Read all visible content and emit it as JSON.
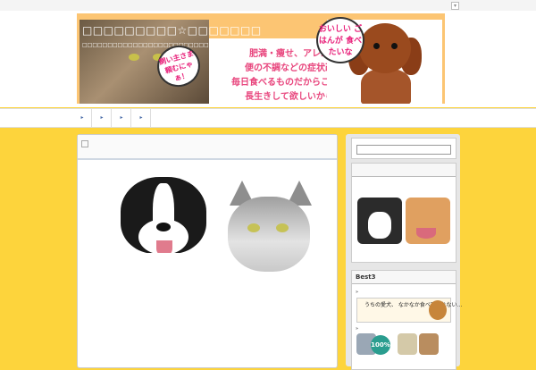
{
  "header": {
    "site_title": "□□□□□□□□□☆□□□□□□□",
    "site_subtitle": "□□□□□□□□□□□□□□□□□□□□□□□□□□□□□□□□□□□□□□",
    "cat_bubble": "飼い主さま 頼むにゃぁ！",
    "dog_bubble": "おいしい ごはんが 食べたいな",
    "tagline_lines": [
      "肥満・痩せ、アレルギー、",
      "便の不調などの症状改善に！",
      "毎日食べるものだからこだわりたい",
      "長生きして欲しいから・・・"
    ]
  },
  "nav": {
    "items": [
      "▸",
      "▸",
      "▸",
      "▸"
    ]
  },
  "sidebar": {
    "best_title": "Best3",
    "bullet1": "»",
    "bullet2": "»",
    "ad1_text": "うちの愛犬、 なかなか食べてくれない…",
    "ad2_badge": "100%"
  }
}
